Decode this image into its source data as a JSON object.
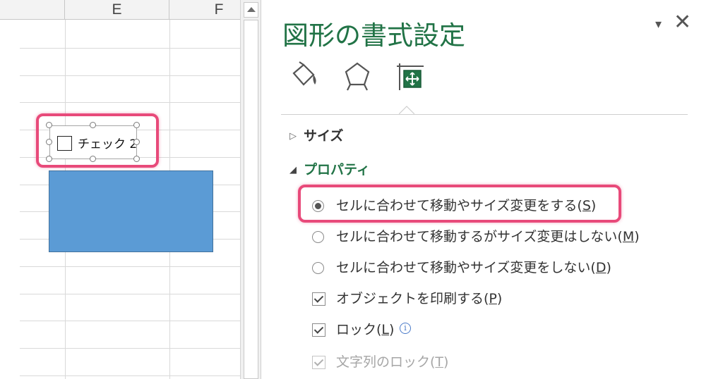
{
  "sheet": {
    "columns": [
      "E",
      "F"
    ],
    "checkbox_control": {
      "label": "チェック 2"
    }
  },
  "pane": {
    "title": "図形の書式設定",
    "menu_glyph": "▾",
    "close_glyph": "✕",
    "tabs": [
      {
        "icon": "fill-line-icon"
      },
      {
        "icon": "effects-icon"
      },
      {
        "icon": "size-properties-icon"
      }
    ],
    "sections": {
      "size": {
        "arrow": "▷",
        "label": "サイズ"
      },
      "properties": {
        "arrow": "◢",
        "label": "プロパティ"
      }
    },
    "options": {
      "move_and_size": {
        "text": "セルに合わせて移動やサイズ変更をする(",
        "key": "S",
        "close": ")",
        "selected": true
      },
      "move_only": {
        "text": "セルに合わせて移動するがサイズ変更はしない(",
        "key": "M",
        "close": ")",
        "selected": false
      },
      "no_move": {
        "text": "セルに合わせて移動やサイズ変更をしない(",
        "key": "D",
        "close": ")",
        "selected": false
      },
      "print_object": {
        "text": "オブジェクトを印刷する(",
        "key": "P",
        "close": ")",
        "checked": true
      },
      "locked": {
        "text": "ロック(",
        "key": "L",
        "close": ")",
        "checked": true,
        "info_glyph": "i"
      },
      "lock_text": {
        "text": "文字列のロック(",
        "key": "T",
        "close": ")",
        "checked": true,
        "disabled": true
      }
    }
  },
  "colors": {
    "accent_green": "#217346",
    "highlight_pink": "#e84a7a",
    "shape_blue": "#5b9bd5"
  }
}
